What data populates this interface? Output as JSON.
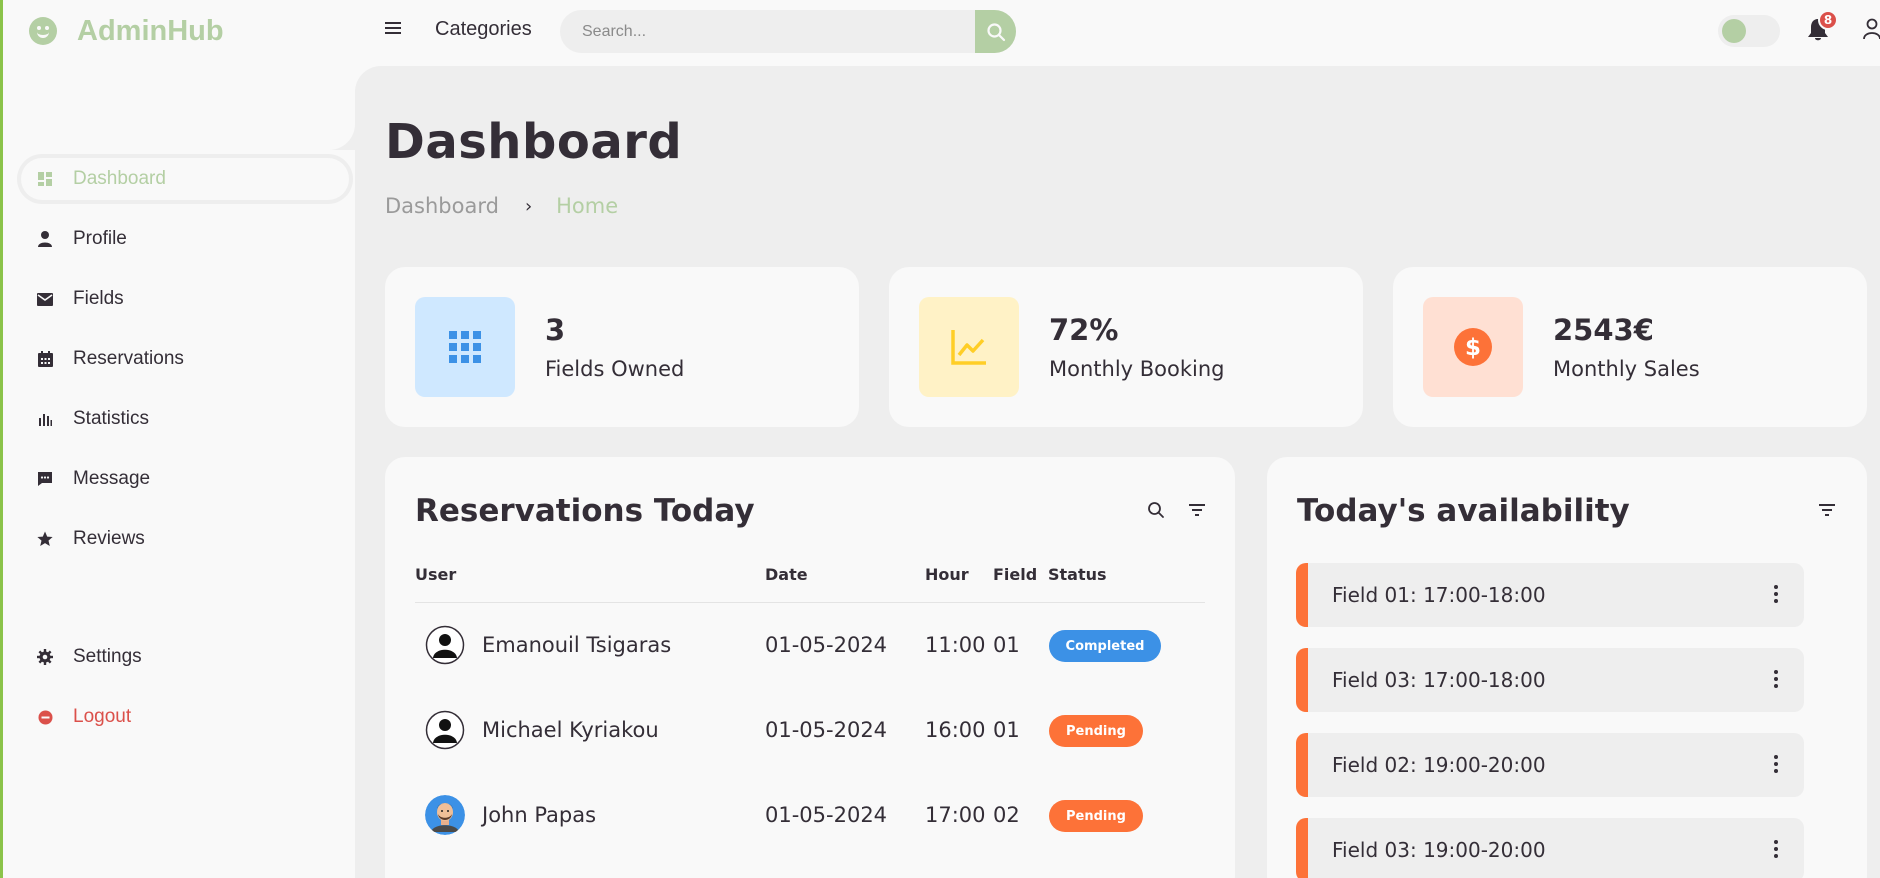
{
  "brand": {
    "name": "AdminHub"
  },
  "sidebar": {
    "items": [
      {
        "label": "Dashboard",
        "icon": "dashboard-icon"
      },
      {
        "label": "Profile",
        "icon": "user-icon"
      },
      {
        "label": "Fields",
        "icon": "envelope-icon"
      },
      {
        "label": "Reservations",
        "icon": "calendar-icon"
      },
      {
        "label": "Statistics",
        "icon": "bar-chart-icon"
      },
      {
        "label": "Message",
        "icon": "message-icon"
      },
      {
        "label": "Reviews",
        "icon": "star-icon"
      }
    ],
    "bottom_items": [
      {
        "label": "Settings",
        "icon": "gear-icon"
      },
      {
        "label": "Logout",
        "icon": "logout-icon"
      }
    ]
  },
  "topbar": {
    "categories": "Categories",
    "search_placeholder": "Search...",
    "notifications_count": "8"
  },
  "page": {
    "title": "Dashboard",
    "breadcrumb": [
      "Dashboard",
      "Home"
    ]
  },
  "stats": [
    {
      "value": "3",
      "label": "Fields Owned",
      "color": "#cfe8ff",
      "icon_color": "#3c91e6"
    },
    {
      "value": "72%",
      "label": "Monthly Booking",
      "color": "#fff2c6",
      "icon_color": "#ffce26"
    },
    {
      "value": "2543€",
      "label": "Monthly Sales",
      "color": "#ffe0d3",
      "icon_color": "#fd7238"
    }
  ],
  "reservations": {
    "title": "Reservations Today",
    "columns": [
      "User",
      "Date",
      "Hour",
      "Field",
      "Status"
    ],
    "rows": [
      {
        "user": "Emanouil Tsigaras",
        "date": "01-05-2024",
        "hour": "11:00",
        "field": "01",
        "status": "Completed"
      },
      {
        "user": "Michael Kyriakou",
        "date": "01-05-2024",
        "hour": "16:00",
        "field": "01",
        "status": "Pending"
      },
      {
        "user": "John Papas",
        "date": "01-05-2024",
        "hour": "17:00",
        "field": "02",
        "status": "Pending"
      }
    ]
  },
  "availability": {
    "title": "Today's availability",
    "items": [
      "Field 01: 17:00-18:00",
      "Field 03: 17:00-18:00",
      "Field 02: 19:00-20:00",
      "Field 03: 19:00-20:00"
    ]
  },
  "colors": {
    "accent": "#b4cfa4",
    "completed": "#3c91e6",
    "pending": "#fd7238",
    "danger": "#db504a"
  }
}
